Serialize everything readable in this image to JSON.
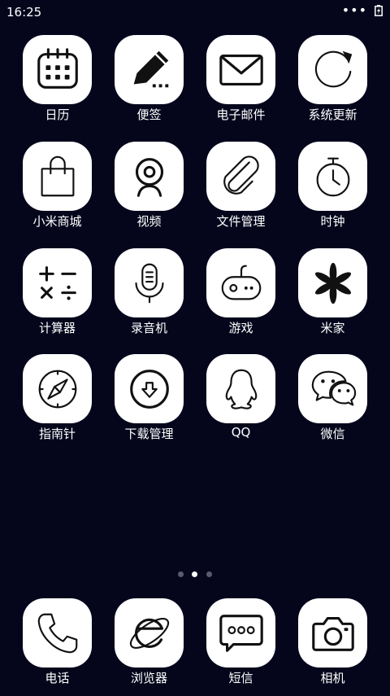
{
  "status_bar": {
    "time": "16:25",
    "more": "•••"
  },
  "apps": [
    {
      "label": "日历",
      "icon": "calendar-icon"
    },
    {
      "label": "便签",
      "icon": "notes-pencil-icon"
    },
    {
      "label": "电子邮件",
      "icon": "mail-envelope-icon"
    },
    {
      "label": "系统更新",
      "icon": "refresh-icon"
    },
    {
      "label": "小米商城",
      "icon": "shopping-bag-icon"
    },
    {
      "label": "视频",
      "icon": "webcam-icon"
    },
    {
      "label": "文件管理",
      "icon": "paperclip-icon"
    },
    {
      "label": "时钟",
      "icon": "stopwatch-icon"
    },
    {
      "label": "计算器",
      "icon": "calculator-icon"
    },
    {
      "label": "录音机",
      "icon": "microphone-icon"
    },
    {
      "label": "游戏",
      "icon": "gamepad-icon"
    },
    {
      "label": "米家",
      "icon": "asterisk-flower-icon"
    },
    {
      "label": "指南针",
      "icon": "compass-icon"
    },
    {
      "label": "下载管理",
      "icon": "download-icon"
    },
    {
      "label": "QQ",
      "icon": "qq-penguin-icon"
    },
    {
      "label": "微信",
      "icon": "wechat-icon"
    }
  ],
  "page_indicator": {
    "pages": 3,
    "current": 2
  },
  "dock": [
    {
      "label": "电话",
      "icon": "phone-icon"
    },
    {
      "label": "浏览器",
      "icon": "browser-icon"
    },
    {
      "label": "短信",
      "icon": "message-icon"
    },
    {
      "label": "相机",
      "icon": "camera-icon"
    }
  ]
}
